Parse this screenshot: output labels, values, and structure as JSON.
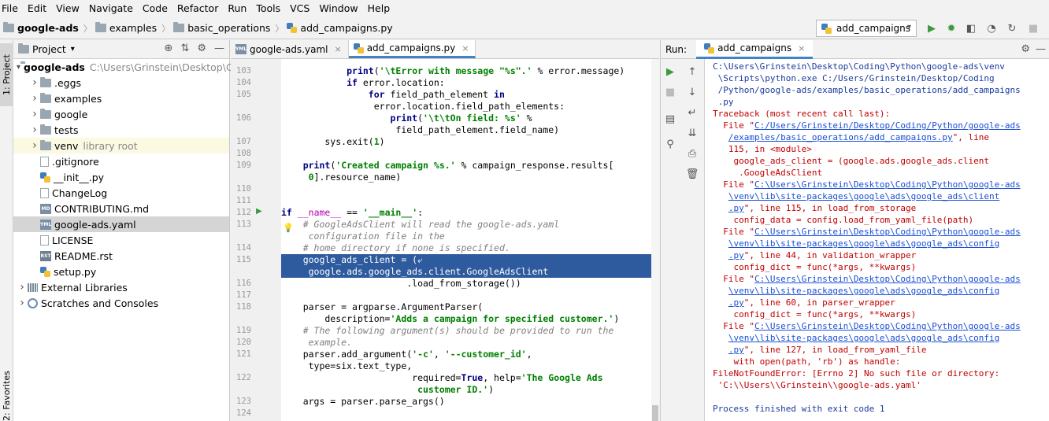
{
  "menu": [
    "File",
    "Edit",
    "View",
    "Navigate",
    "Code",
    "Refactor",
    "Run",
    "Tools",
    "VCS",
    "Window",
    "Help"
  ],
  "breadcrumb": [
    "google-ads",
    "examples",
    "basic_operations",
    "add_campaigns.py"
  ],
  "run_config": "add_campaigns",
  "side_tabs": {
    "project": "1: Project",
    "favorites": "2: Favorites"
  },
  "project": {
    "title": "Project",
    "root_name": "google-ads",
    "root_path": "C:\\Users\\Grinstein\\Desktop\\Cod",
    "items": [
      {
        "label": "google-ads",
        "note": "C:\\Users\\Grinstein\\Desktop\\Cod",
        "icon": "folder",
        "indent": 0,
        "expand": "open"
      },
      {
        "label": ".eggs",
        "note": "",
        "icon": "folder",
        "indent": 1,
        "expand": "closed"
      },
      {
        "label": "examples",
        "note": "",
        "icon": "folder",
        "indent": 1,
        "expand": "closed"
      },
      {
        "label": "google",
        "note": "",
        "icon": "folder",
        "indent": 1,
        "expand": "closed"
      },
      {
        "label": "tests",
        "note": "",
        "icon": "folder",
        "indent": 1,
        "expand": "closed"
      },
      {
        "label": "venv",
        "note": "library root",
        "icon": "folder",
        "indent": 1,
        "expand": "closed",
        "highlight": true
      },
      {
        "label": ".gitignore",
        "note": "",
        "icon": "file",
        "indent": 1,
        "expand": ""
      },
      {
        "label": "__init__.py",
        "note": "",
        "icon": "py",
        "indent": 1,
        "expand": ""
      },
      {
        "label": "ChangeLog",
        "note": "",
        "icon": "file",
        "indent": 1,
        "expand": ""
      },
      {
        "label": "CONTRIBUTING.md",
        "note": "",
        "icon": "md",
        "indent": 1,
        "expand": ""
      },
      {
        "label": "google-ads.yaml",
        "note": "",
        "icon": "yml",
        "indent": 1,
        "expand": "",
        "selected": true
      },
      {
        "label": "LICENSE",
        "note": "",
        "icon": "file",
        "indent": 1,
        "expand": ""
      },
      {
        "label": "README.rst",
        "note": "",
        "icon": "rst",
        "indent": 1,
        "expand": ""
      },
      {
        "label": "setup.py",
        "note": "",
        "icon": "py",
        "indent": 1,
        "expand": ""
      },
      {
        "label": "External Libraries",
        "note": "",
        "icon": "lib",
        "indent": 0,
        "expand": "closed"
      },
      {
        "label": "Scratches and Consoles",
        "note": "",
        "icon": "scratch",
        "indent": 0,
        "expand": "closed"
      }
    ]
  },
  "editor": {
    "tabs": [
      {
        "label": "google-ads.yaml",
        "icon": "yml",
        "active": false
      },
      {
        "label": "add_campaigns.py",
        "icon": "py",
        "active": true
      }
    ],
    "lines": [
      {
        "n": "103",
        "html": "            <span class=\"kw\">print</span>(<span class=\"st\">'\\tError with message \"%s\".'</span> % error.message)"
      },
      {
        "n": "104",
        "html": "            <span class=\"kw\">if</span> error.location:"
      },
      {
        "n": "105",
        "html": "                <span class=\"kw\">for</span> field_path_element <span class=\"kw\">in</span>"
      },
      {
        "n": "",
        "html": "                 error.location.field_path_elements:"
      },
      {
        "n": "106",
        "html": "                    <span class=\"kw\">print</span>(<span class=\"st\">'\\t\\tOn field: %s'</span> %"
      },
      {
        "n": "",
        "html": "                     field_path_element.field_name)"
      },
      {
        "n": "107",
        "html": "        sys.exit(<span class=\"st\">1</span>)"
      },
      {
        "n": "108",
        "html": ""
      },
      {
        "n": "109",
        "html": "    <span class=\"kw\">print</span>(<span class=\"st\">'Created campaign %s.'</span> % campaign_response.results["
      },
      {
        "n": "",
        "html": "     <span class=\"st\">0</span>].resource_name)"
      },
      {
        "n": "110",
        "html": ""
      },
      {
        "n": "111",
        "html": ""
      },
      {
        "n": "112",
        "html": "<span class=\"kw\">if</span> <span class=\"dn\">__name__</span> == <span class=\"st\">'__main__'</span>:"
      },
      {
        "n": "113",
        "html": "    <span class=\"cm\"># GoogleAdsClient will read the google-ads.yaml</span>"
      },
      {
        "n": "",
        "html": "     <span class=\"cm\">configuration file in the</span>"
      },
      {
        "n": "114",
        "html": "    <span class=\"cm\"># home directory if none is specified.</span>"
      },
      {
        "n": "115",
        "html": "<span class=\"sl\">    google_ads_client = (⤶</span>",
        "selected": true
      },
      {
        "n": "",
        "html": "<span class=\"sl\">     google.ads.google_ads.client.GoogleAdsClient</span>",
        "selected": true
      },
      {
        "n": "116",
        "html": "                       .load_from_storage())"
      },
      {
        "n": "117",
        "html": ""
      },
      {
        "n": "118",
        "html": "    parser = argparse.ArgumentParser("
      },
      {
        "n": "",
        "html": "        description=<span class=\"st\">'Adds a campaign for specified customer.'</span>)"
      },
      {
        "n": "119",
        "html": "    <span class=\"cm\"># The following argument(s) should be provided to run the</span>"
      },
      {
        "n": "120",
        "html": "     <span class=\"cm\">example.</span>"
      },
      {
        "n": "121",
        "html": "    parser.add_argument(<span class=\"st\">'-c'</span>, <span class=\"st\">'--customer_id'</span>,"
      },
      {
        "n": "",
        "html": "     type=six.text_type,"
      },
      {
        "n": "122",
        "html": "                        required=<span class=\"kw\">True</span>, help=<span class=\"st\">'The Google Ads</span>"
      },
      {
        "n": "",
        "html": "<span class=\"st\">                         customer ID.'</span>)"
      },
      {
        "n": "123",
        "html": "    args = parser.parse_args()"
      },
      {
        "n": "124",
        "html": ""
      }
    ]
  },
  "run": {
    "label": "Run:",
    "tab": "add_campaigns",
    "console": [
      {
        "t": "C:\\Users\\Grinstein\\Desktop\\Coding\\Python\\google-ads\\venv",
        "c": "blue"
      },
      {
        "t": " \\Scripts\\python.exe C:/Users/Grinstein/Desktop/Coding",
        "c": "blue"
      },
      {
        "t": " /Python/google-ads/examples/basic_operations/add_campaigns",
        "c": "blue"
      },
      {
        "t": " .py",
        "c": "blue"
      },
      {
        "t": "Traceback (most recent call last):",
        "c": "red"
      },
      {
        "t": "  File \"",
        "link": "C:/Users/Grinstein/Desktop/Coding/Python/google-ads",
        "c": "red"
      },
      {
        "t": "   ",
        "link": "/examples/basic_operations/add_campaigns.py",
        "tail": "\", line",
        "c": "red"
      },
      {
        "t": "   115, in <module>",
        "c": "red"
      },
      {
        "t": "    google_ads_client = (google.ads.google_ads.client",
        "c": "red"
      },
      {
        "t": "     .GoogleAdsClient",
        "c": "red"
      },
      {
        "t": "  File \"",
        "link": "C:\\Users\\Grinstein\\Desktop\\Coding\\Python\\google-ads",
        "c": "red"
      },
      {
        "t": "   ",
        "link": "\\venv\\lib\\site-packages\\google\\ads\\google_ads\\client",
        "c": "red"
      },
      {
        "t": "   ",
        "link": ".py",
        "tail": "\", line 115, in load_from_storage",
        "c": "red"
      },
      {
        "t": "    config_data = config.load_from_yaml_file(path)",
        "c": "red"
      },
      {
        "t": "  File \"",
        "link": "C:\\Users\\Grinstein\\Desktop\\Coding\\Python\\google-ads",
        "c": "red"
      },
      {
        "t": "   ",
        "link": "\\venv\\lib\\site-packages\\google\\ads\\google_ads\\config",
        "c": "red"
      },
      {
        "t": "   ",
        "link": ".py",
        "tail": "\", line 44, in validation_wrapper",
        "c": "red"
      },
      {
        "t": "    config_dict = func(*args, **kwargs)",
        "c": "red"
      },
      {
        "t": "  File \"",
        "link": "C:\\Users\\Grinstein\\Desktop\\Coding\\Python\\google-ads",
        "c": "red"
      },
      {
        "t": "   ",
        "link": "\\venv\\lib\\site-packages\\google\\ads\\google_ads\\config",
        "c": "red"
      },
      {
        "t": "   ",
        "link": ".py",
        "tail": "\", line 60, in parser_wrapper",
        "c": "red"
      },
      {
        "t": "    config_dict = func(*args, **kwargs)",
        "c": "red"
      },
      {
        "t": "  File \"",
        "link": "C:\\Users\\Grinstein\\Desktop\\Coding\\Python\\google-ads",
        "c": "red"
      },
      {
        "t": "   ",
        "link": "\\venv\\lib\\site-packages\\google\\ads\\google_ads\\config",
        "c": "red"
      },
      {
        "t": "   ",
        "link": ".py",
        "tail": "\", line 127, in load_from_yaml_file",
        "c": "red"
      },
      {
        "t": "    with open(path, 'rb') as handle:",
        "c": "red"
      },
      {
        "t": "FileNotFoundError: [Errno 2] No such file or directory:",
        "c": "red"
      },
      {
        "t": " 'C:\\\\Users\\\\Grinstein\\\\google-ads.yaml'",
        "c": "red"
      },
      {
        "t": "",
        "c": "red"
      },
      {
        "t": "Process finished with exit code 1",
        "c": "blue"
      }
    ]
  },
  "colors": {
    "selection": "#2e5b9e",
    "error": "#c00000",
    "link": "#1a4fd6",
    "accent": "#4083c9"
  }
}
